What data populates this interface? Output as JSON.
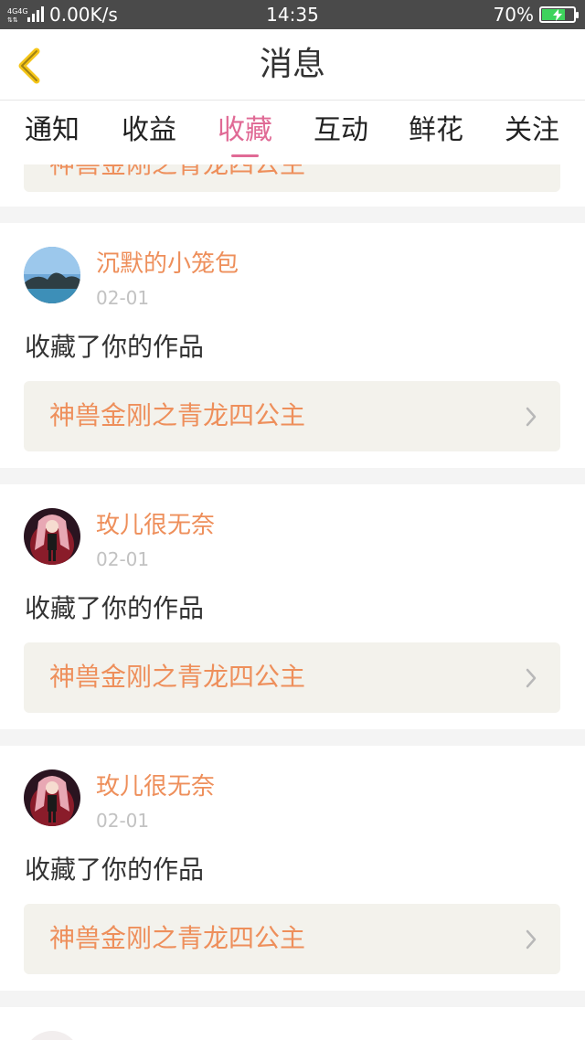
{
  "status_bar": {
    "network": "4G 4G",
    "speed": "0.00K/s",
    "time": "14:35",
    "battery": "70%",
    "battery_level": 0.7,
    "battery_color": "#3ed35c"
  },
  "nav": {
    "title": "消息",
    "back_icon": "chevron-left-icon",
    "accent": "#f5c518"
  },
  "tabs": [
    {
      "label": "通知",
      "active": false
    },
    {
      "label": "收益",
      "active": false
    },
    {
      "label": "收藏",
      "active": true
    },
    {
      "label": "互动",
      "active": false
    },
    {
      "label": "鲜花",
      "active": false
    },
    {
      "label": "关注",
      "active": false
    }
  ],
  "colors": {
    "accent_pink": "#e06a95",
    "name_orange": "#ee8f5b",
    "card_box": "#f3f2ec"
  },
  "partial_top": {
    "work_title": "神兽金刚之青龙四公主"
  },
  "items": [
    {
      "user": "沉默的小笼包",
      "avatar": "landscape-avatar",
      "date": "02-01",
      "action": "收藏了你的作品",
      "work_title": "神兽金刚之青龙四公主"
    },
    {
      "user": "玫儿很无奈",
      "avatar": "anime-girl-avatar",
      "date": "02-01",
      "action": "收藏了你的作品",
      "work_title": "神兽金刚之青龙四公主"
    },
    {
      "user": "玫儿很无奈",
      "avatar": "anime-girl-avatar",
      "date": "02-01",
      "action": "收藏了你的作品",
      "work_title": "神兽金刚之青龙四公主"
    }
  ]
}
